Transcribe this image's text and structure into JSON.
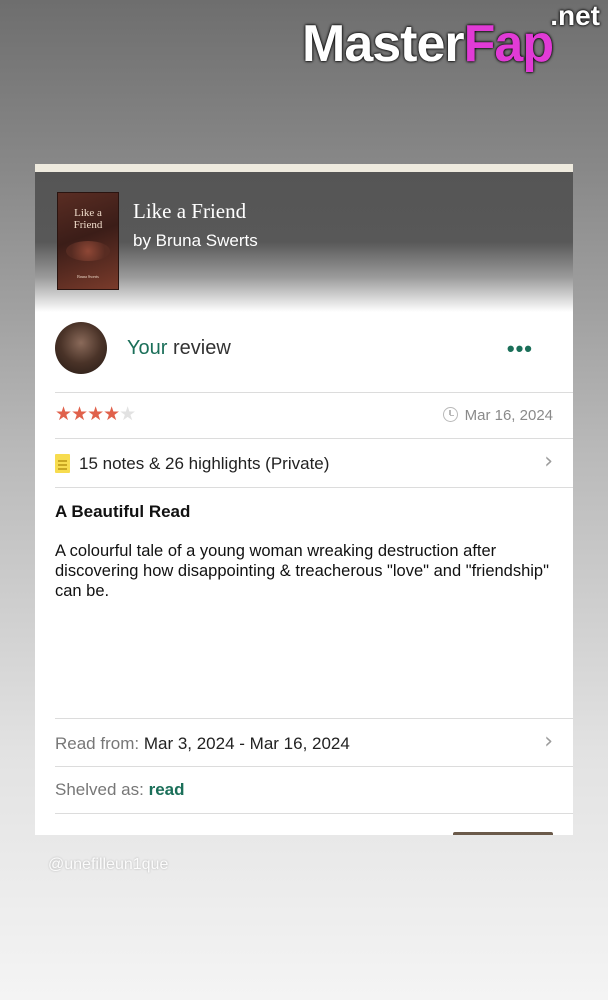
{
  "watermark": {
    "main": "Master",
    "accent": "Fap",
    "tld": ".net"
  },
  "book": {
    "title": "Like a Friend",
    "author": "by Bruna Swerts",
    "cover_title": "Like a Friend",
    "cover_author": "Bruna Swerts"
  },
  "review": {
    "heading_your": "Your",
    "heading_rest": " review",
    "more_label": "•••",
    "rating": 4,
    "rating_max": 5,
    "stars_on": "★★★★",
    "stars_off": "★",
    "date": "Mar 16, 2024",
    "notes_label": "15 notes & 26 highlights (Private)",
    "headline": "A Beautiful Read",
    "body": "A colourful tale of a young woman wreaking destruction after discovering how disappointing & treacherous \"love\" and \"friendship\" can be.",
    "read_from_label": "Read from:",
    "read_from_value": "Mar 3, 2024 - Mar 16, 2024",
    "shelved_label": "Shelved as:",
    "shelved_value": "read"
  },
  "icons": {
    "chevron": "›",
    "clock": "clock-icon",
    "notes": "note-icon"
  },
  "colors": {
    "accent_green": "#1b6f59",
    "star": "#e0614b",
    "watermark_accent": "#e13bd6"
  },
  "handle": "@unefilleun1que"
}
